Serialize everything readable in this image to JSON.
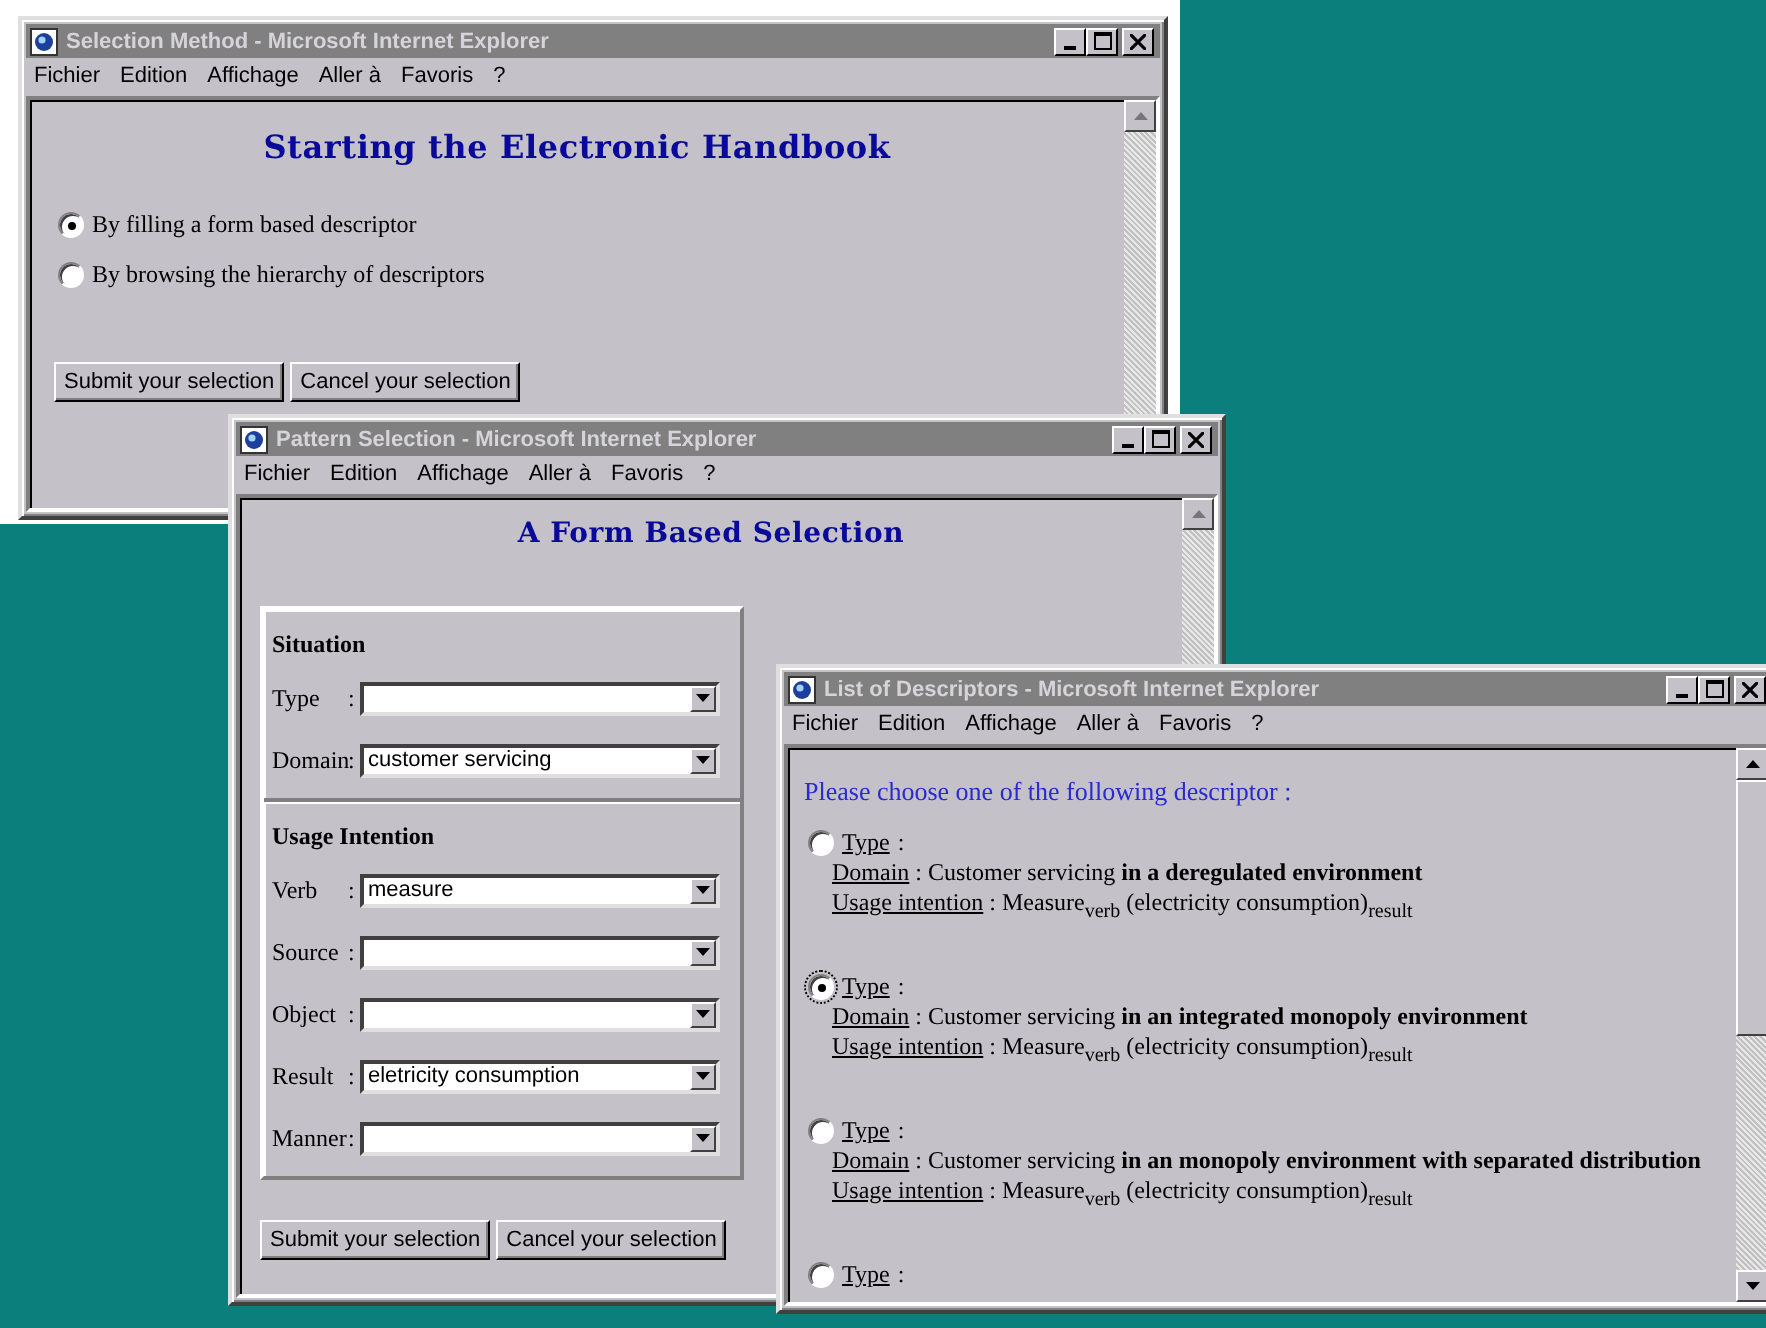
{
  "windows": [
    {
      "kind": "method",
      "title": "Selection Method  - Microsoft Internet Explorer",
      "menu": [
        "Fichier",
        "Edition",
        "Affichage",
        "Aller à",
        "Favoris",
        "?"
      ],
      "heading": "Starting the Electronic Handbook",
      "options": [
        {
          "label": "By filling a form based descriptor",
          "selected": true
        },
        {
          "label": "By browsing the hierarchy of descriptors",
          "selected": false
        }
      ],
      "buttons": [
        "Submit your selection",
        "Cancel your selection"
      ]
    },
    {
      "kind": "pattern",
      "title": "Pattern Selection  - Microsoft Internet Explorer",
      "menu": [
        "Fichier",
        "Edition",
        "Affichage",
        "Aller à",
        "Favoris",
        "?"
      ],
      "heading": "A Form Based Selection",
      "sections": [
        {
          "title": "Situation",
          "fields": [
            {
              "label": "Type",
              "colon": ":"
            },
            {
              "label": "Domain",
              "colon": ":",
              "value": "customer servicing"
            }
          ]
        },
        {
          "title": "Usage Intention",
          "fields": [
            {
              "label": "Verb",
              "colon": ":",
              "value": "measure"
            },
            {
              "label": "Source",
              "colon": ":"
            },
            {
              "label": "Object",
              "colon": ":"
            },
            {
              "label": "Result",
              "colon": ":",
              "value": "eletricity consumption"
            },
            {
              "label": "Manner",
              "colon": ":"
            }
          ]
        }
      ],
      "buttons": [
        "Submit your selection",
        "Cancel your selection"
      ]
    },
    {
      "kind": "descriptors",
      "title": "List of Descriptors  - Microsoft Internet Explorer",
      "menu": [
        "Fichier",
        "Edition",
        "Affichage",
        "Aller à",
        "Favoris",
        "?"
      ],
      "prompt": "Please choose one of the following descriptor :",
      "descriptors": [
        {
          "selected": false,
          "type_label": "Type",
          "type_colon": ":",
          "domain_label": "Domain",
          "domain": ": Customer servicing **in a deregulated environment**",
          "usage_label": "Usage intention",
          "usage": ": Measure$_{verb}$ (electricity consumption)$_{result}$"
        },
        {
          "selected": true,
          "type_label": "Type",
          "type_colon": ":",
          "domain_label": "Domain",
          "domain": ": Customer servicing **in an integrated monopoly environment**",
          "usage_label": "Usage intention",
          "usage": ": Measure$_{verb}$ (electricity consumption)$_{result}$"
        },
        {
          "selected": false,
          "type_label": "Type",
          "type_colon": ":",
          "domain_label": "Domain",
          "domain": ": Customer servicing **in an monopoly environment with separated distribution**",
          "usage_label": "Usage intention",
          "usage": ": Measure$_{verb}$ (electricity consumption)$_{result}$"
        },
        {
          "selected": false,
          "type_label": "Type",
          "type_colon": ":"
        }
      ]
    }
  ]
}
